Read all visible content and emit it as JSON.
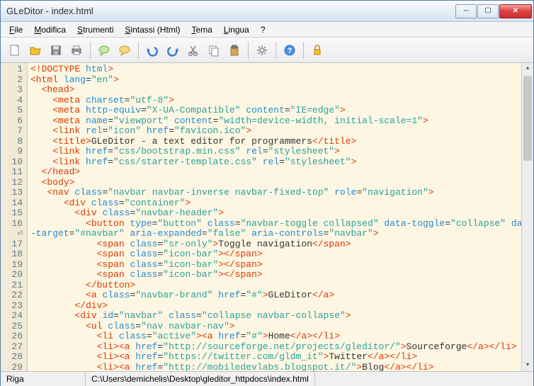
{
  "window": {
    "title": "GLeDitor - index.html"
  },
  "menu": {
    "file": "File",
    "file_u": "F",
    "modifica": "Modifica",
    "modifica_u": "M",
    "strumenti": "Strumenti",
    "strumenti_u": "S",
    "sintassi": "Sintassi (Html)",
    "sintassi_u": "S",
    "tema": "Tema",
    "tema_u": "T",
    "lingua": "Lingua",
    "lingua_u": "L",
    "help": "?"
  },
  "gutter": {
    "lines": "1\n2\n3\n4\n5\n6\n7\n8\n9\n10\n11\n12\n13\n14\n15\n16\n⏎\n17\n18\n19\n20\n21\n22\n23\n24\n25\n26\n27\n28\n29"
  },
  "code": [
    {
      "segs": [
        [
          "t",
          "<!DOCTYPE "
        ],
        [
          "a",
          "html"
        ],
        [
          "t",
          ">"
        ]
      ]
    },
    {
      "segs": [
        [
          "t",
          "<html "
        ],
        [
          "a",
          "lang"
        ],
        [
          "p",
          "="
        ],
        [
          "s",
          "\"en\""
        ],
        [
          "t",
          ">"
        ]
      ]
    },
    {
      "segs": [
        [
          "p",
          "  "
        ],
        [
          "t",
          "<head>"
        ]
      ]
    },
    {
      "segs": [
        [
          "p",
          "    "
        ],
        [
          "t",
          "<meta "
        ],
        [
          "a",
          "charset"
        ],
        [
          "p",
          "="
        ],
        [
          "s",
          "\"utf-8\""
        ],
        [
          "t",
          ">"
        ]
      ]
    },
    {
      "segs": [
        [
          "p",
          "    "
        ],
        [
          "t",
          "<meta "
        ],
        [
          "a",
          "http-equiv"
        ],
        [
          "p",
          "="
        ],
        [
          "s",
          "\"X-UA-Compatible\""
        ],
        [
          "p",
          " "
        ],
        [
          "a",
          "content"
        ],
        [
          "p",
          "="
        ],
        [
          "s",
          "\"IE=edge\""
        ],
        [
          "t",
          ">"
        ]
      ]
    },
    {
      "segs": [
        [
          "p",
          "    "
        ],
        [
          "t",
          "<meta "
        ],
        [
          "a",
          "name"
        ],
        [
          "p",
          "="
        ],
        [
          "s",
          "\"viewport\""
        ],
        [
          "p",
          " "
        ],
        [
          "a",
          "content"
        ],
        [
          "p",
          "="
        ],
        [
          "s",
          "\"width=device-width, initial-scale=1\""
        ],
        [
          "t",
          ">"
        ]
      ]
    },
    {
      "segs": [
        [
          "p",
          "    "
        ],
        [
          "t",
          "<link "
        ],
        [
          "a",
          "rel"
        ],
        [
          "p",
          "="
        ],
        [
          "s",
          "\"icon\""
        ],
        [
          "p",
          " "
        ],
        [
          "a",
          "href"
        ],
        [
          "p",
          "="
        ],
        [
          "s",
          "\"favicon.ico\""
        ],
        [
          "t",
          ">"
        ]
      ]
    },
    {
      "segs": [
        [
          "p",
          "    "
        ],
        [
          "t",
          "<title>"
        ],
        [
          "p",
          "GLeDitor - a text editor for programmers"
        ],
        [
          "t",
          "</title>"
        ]
      ]
    },
    {
      "segs": [
        [
          "p",
          "    "
        ],
        [
          "t",
          "<link "
        ],
        [
          "a",
          "href"
        ],
        [
          "p",
          "="
        ],
        [
          "s",
          "\"css/bootstrap.min.css\""
        ],
        [
          "p",
          " "
        ],
        [
          "a",
          "rel"
        ],
        [
          "p",
          "="
        ],
        [
          "s",
          "\"stylesheet\""
        ],
        [
          "t",
          ">"
        ]
      ]
    },
    {
      "segs": [
        [
          "p",
          "    "
        ],
        [
          "t",
          "<link "
        ],
        [
          "a",
          "href"
        ],
        [
          "p",
          "="
        ],
        [
          "s",
          "\"css/starter-template.css\""
        ],
        [
          "p",
          " "
        ],
        [
          "a",
          "rel"
        ],
        [
          "p",
          "="
        ],
        [
          "s",
          "\"stylesheet\""
        ],
        [
          "t",
          ">"
        ]
      ]
    },
    {
      "segs": [
        [
          "p",
          "  "
        ],
        [
          "t",
          "</head>"
        ]
      ]
    },
    {
      "segs": [
        [
          "p",
          "  "
        ],
        [
          "t",
          "<body>"
        ]
      ]
    },
    {
      "segs": [
        [
          "p",
          "   "
        ],
        [
          "t",
          "<nav "
        ],
        [
          "a",
          "class"
        ],
        [
          "p",
          "="
        ],
        [
          "s",
          "\"navbar navbar-inverse navbar-fixed-top\""
        ],
        [
          "p",
          " "
        ],
        [
          "a",
          "role"
        ],
        [
          "p",
          "="
        ],
        [
          "s",
          "\"navigation\""
        ],
        [
          "t",
          ">"
        ]
      ]
    },
    {
      "segs": [
        [
          "p",
          "      "
        ],
        [
          "t",
          "<div "
        ],
        [
          "a",
          "class"
        ],
        [
          "p",
          "="
        ],
        [
          "s",
          "\"container\""
        ],
        [
          "t",
          ">"
        ]
      ]
    },
    {
      "segs": [
        [
          "p",
          "        "
        ],
        [
          "t",
          "<div "
        ],
        [
          "a",
          "class"
        ],
        [
          "p",
          "="
        ],
        [
          "s",
          "\"navbar-header\""
        ],
        [
          "t",
          ">"
        ]
      ]
    },
    {
      "segs": [
        [
          "p",
          "          "
        ],
        [
          "t",
          "<button "
        ],
        [
          "a",
          "type"
        ],
        [
          "p",
          "="
        ],
        [
          "s",
          "\"button\""
        ],
        [
          "p",
          " "
        ],
        [
          "a",
          "class"
        ],
        [
          "p",
          "="
        ],
        [
          "s",
          "\"navbar-toggle collapsed\""
        ],
        [
          "p",
          " "
        ],
        [
          "a",
          "data-toggle"
        ],
        [
          "p",
          "="
        ],
        [
          "s",
          "\"collapse\""
        ],
        [
          "p",
          " "
        ],
        [
          "a",
          "data"
        ]
      ]
    },
    {
      "segs": [
        [
          "a",
          "-target"
        ],
        [
          "p",
          "="
        ],
        [
          "s",
          "\"#navbar\""
        ],
        [
          "p",
          " "
        ],
        [
          "a",
          "aria-expanded"
        ],
        [
          "p",
          "="
        ],
        [
          "s",
          "\"false\""
        ],
        [
          "p",
          " "
        ],
        [
          "a",
          "aria-controls"
        ],
        [
          "p",
          "="
        ],
        [
          "s",
          "\"navbar\""
        ],
        [
          "t",
          ">"
        ]
      ]
    },
    {
      "segs": [
        [
          "p",
          "            "
        ],
        [
          "t",
          "<span "
        ],
        [
          "a",
          "class"
        ],
        [
          "p",
          "="
        ],
        [
          "s",
          "\"sr-only\""
        ],
        [
          "t",
          ">"
        ],
        [
          "p",
          "Toggle navigation"
        ],
        [
          "t",
          "</span>"
        ]
      ]
    },
    {
      "segs": [
        [
          "p",
          "            "
        ],
        [
          "t",
          "<span "
        ],
        [
          "a",
          "class"
        ],
        [
          "p",
          "="
        ],
        [
          "s",
          "\"icon-bar\""
        ],
        [
          "t",
          "></span>"
        ]
      ]
    },
    {
      "segs": [
        [
          "p",
          "            "
        ],
        [
          "t",
          "<span "
        ],
        [
          "a",
          "class"
        ],
        [
          "p",
          "="
        ],
        [
          "s",
          "\"icon-bar\""
        ],
        [
          "t",
          "></span>"
        ]
      ]
    },
    {
      "segs": [
        [
          "p",
          "            "
        ],
        [
          "t",
          "<span "
        ],
        [
          "a",
          "class"
        ],
        [
          "p",
          "="
        ],
        [
          "s",
          "\"icon-bar\""
        ],
        [
          "t",
          "></span>"
        ]
      ]
    },
    {
      "segs": [
        [
          "p",
          "          "
        ],
        [
          "t",
          "</button>"
        ]
      ]
    },
    {
      "segs": [
        [
          "p",
          "          "
        ],
        [
          "t",
          "<a "
        ],
        [
          "a",
          "class"
        ],
        [
          "p",
          "="
        ],
        [
          "s",
          "\"navbar-brand\""
        ],
        [
          "p",
          " "
        ],
        [
          "a",
          "href"
        ],
        [
          "p",
          "="
        ],
        [
          "s",
          "\"#\""
        ],
        [
          "t",
          ">"
        ],
        [
          "p",
          "GLeDitor"
        ],
        [
          "t",
          "</a>"
        ]
      ]
    },
    {
      "segs": [
        [
          "p",
          "        "
        ],
        [
          "t",
          "</div>"
        ]
      ]
    },
    {
      "segs": [
        [
          "p",
          "        "
        ],
        [
          "t",
          "<div "
        ],
        [
          "a",
          "id"
        ],
        [
          "p",
          "="
        ],
        [
          "s",
          "\"navbar\""
        ],
        [
          "p",
          " "
        ],
        [
          "a",
          "class"
        ],
        [
          "p",
          "="
        ],
        [
          "s",
          "\"collapse navbar-collapse\""
        ],
        [
          "t",
          ">"
        ]
      ]
    },
    {
      "segs": [
        [
          "p",
          "          "
        ],
        [
          "t",
          "<ul "
        ],
        [
          "a",
          "class"
        ],
        [
          "p",
          "="
        ],
        [
          "s",
          "\"nav navbar-nav\""
        ],
        [
          "t",
          ">"
        ]
      ]
    },
    {
      "segs": [
        [
          "p",
          "            "
        ],
        [
          "t",
          "<li "
        ],
        [
          "a",
          "class"
        ],
        [
          "p",
          "="
        ],
        [
          "s",
          "\"active\""
        ],
        [
          "t",
          "><a "
        ],
        [
          "a",
          "href"
        ],
        [
          "p",
          "="
        ],
        [
          "s",
          "\"#\""
        ],
        [
          "t",
          ">"
        ],
        [
          "p",
          "Home"
        ],
        [
          "t",
          "</a></li>"
        ]
      ]
    },
    {
      "segs": [
        [
          "p",
          "            "
        ],
        [
          "t",
          "<li><a "
        ],
        [
          "a",
          "href"
        ],
        [
          "p",
          "="
        ],
        [
          "s",
          "\"http://sourceforge.net/projects/gleditor/\""
        ],
        [
          "t",
          ">"
        ],
        [
          "p",
          "Sourceforge"
        ],
        [
          "t",
          "</a></li>"
        ]
      ]
    },
    {
      "segs": [
        [
          "p",
          "            "
        ],
        [
          "t",
          "<li><a "
        ],
        [
          "a",
          "href"
        ],
        [
          "p",
          "="
        ],
        [
          "s",
          "\"https://twitter.com/gldm_it\""
        ],
        [
          "t",
          ">"
        ],
        [
          "p",
          "Twitter"
        ],
        [
          "t",
          "</a></li>"
        ]
      ]
    },
    {
      "segs": [
        [
          "p",
          "            "
        ],
        [
          "t",
          "<li><a "
        ],
        [
          "a",
          "href"
        ],
        [
          "p",
          "="
        ],
        [
          "s",
          "\"http://mobiledevlabs.blogspot.it/\""
        ],
        [
          "t",
          ">"
        ],
        [
          "p",
          "Blog"
        ],
        [
          "t",
          "</a></li>"
        ]
      ]
    }
  ],
  "status": {
    "riga": "Riga",
    "path": "C:\\Users\\demichelis\\Desktop\\gleditor_httpdocs\\index.html"
  }
}
